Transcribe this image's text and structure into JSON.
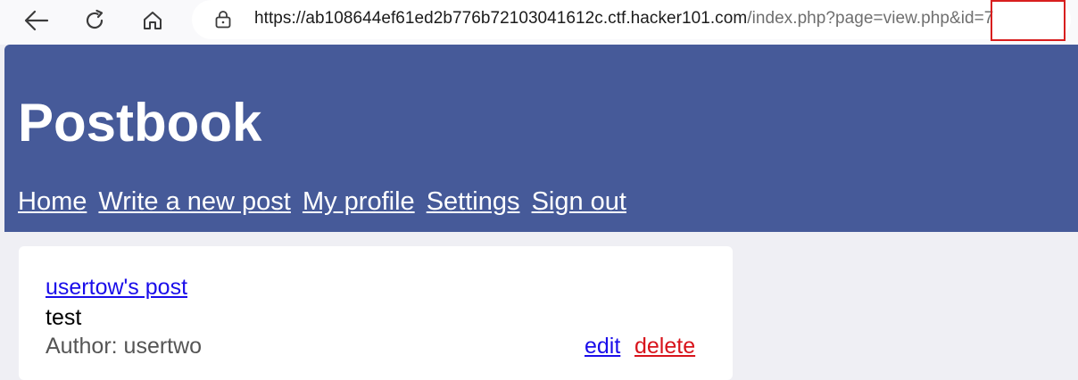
{
  "browser": {
    "url_host": "https://ab108644ef61ed2b776b72103041612c.ctf.hacker101.com",
    "url_path": "/index.php?page=view.php&id=7"
  },
  "header": {
    "title": "Postbook",
    "nav": [
      "Home",
      "Write a new post",
      "My profile",
      "Settings",
      "Sign out"
    ]
  },
  "post": {
    "title": "usertow's post",
    "body": "test",
    "author": "Author: usertwo",
    "edit_label": "edit",
    "delete_label": "delete"
  },
  "colors": {
    "header_bg": "#465a99",
    "link": "#1a0dea",
    "delete": "#d8131b",
    "highlight": "#d81e1e"
  }
}
